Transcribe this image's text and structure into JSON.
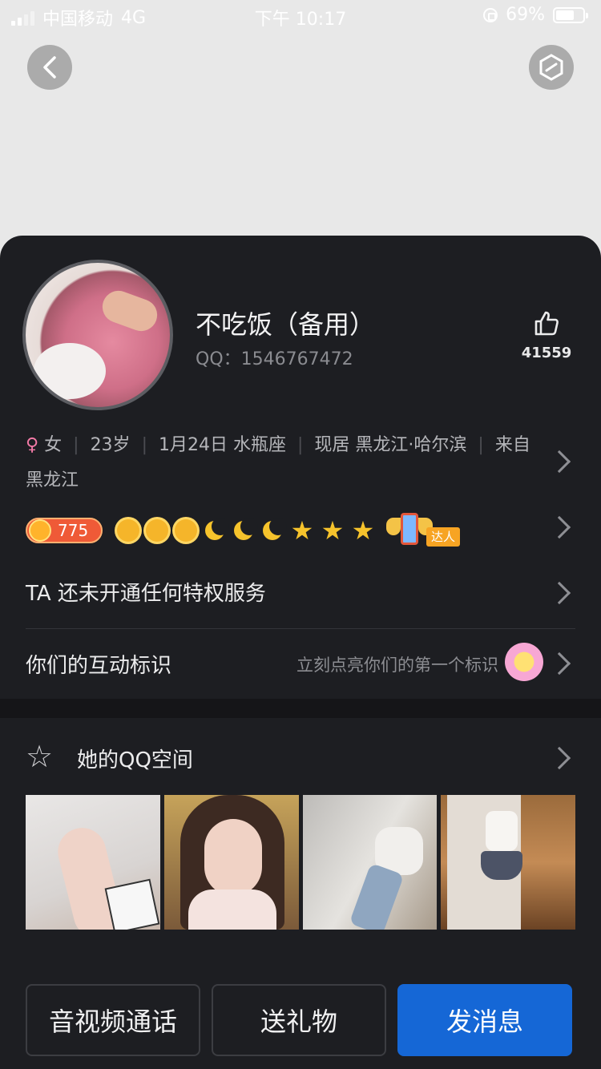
{
  "status_bar": {
    "carrier": "中国移动",
    "network": "4G",
    "time": "下午 10:17",
    "battery": "69%",
    "battery_level": 0.69
  },
  "profile": {
    "nickname": "不吃饭（备用）",
    "qq_label": "QQ：1546767472",
    "like_count": "41559"
  },
  "info": {
    "gender": "女",
    "age": "23岁",
    "birthday": "1月24日 水瓶座",
    "residence": "现居 黑龙江·哈尔滨",
    "hometown": "来自 黑龙江"
  },
  "level": {
    "level_number": "775",
    "talent_tag": "达人"
  },
  "privilege": {
    "label": "TA 还未开通任何特权服务"
  },
  "interaction": {
    "label": "你们的互动标识",
    "hint": "立刻点亮你们的第一个标识"
  },
  "qzone": {
    "title": "她的QQ空间"
  },
  "actions": {
    "call": "音视频通话",
    "gift": "送礼物",
    "message": "发消息"
  },
  "colors": {
    "card_bg": "#1d1e22",
    "accent": "#1567d6",
    "female": "#f27aa6"
  }
}
